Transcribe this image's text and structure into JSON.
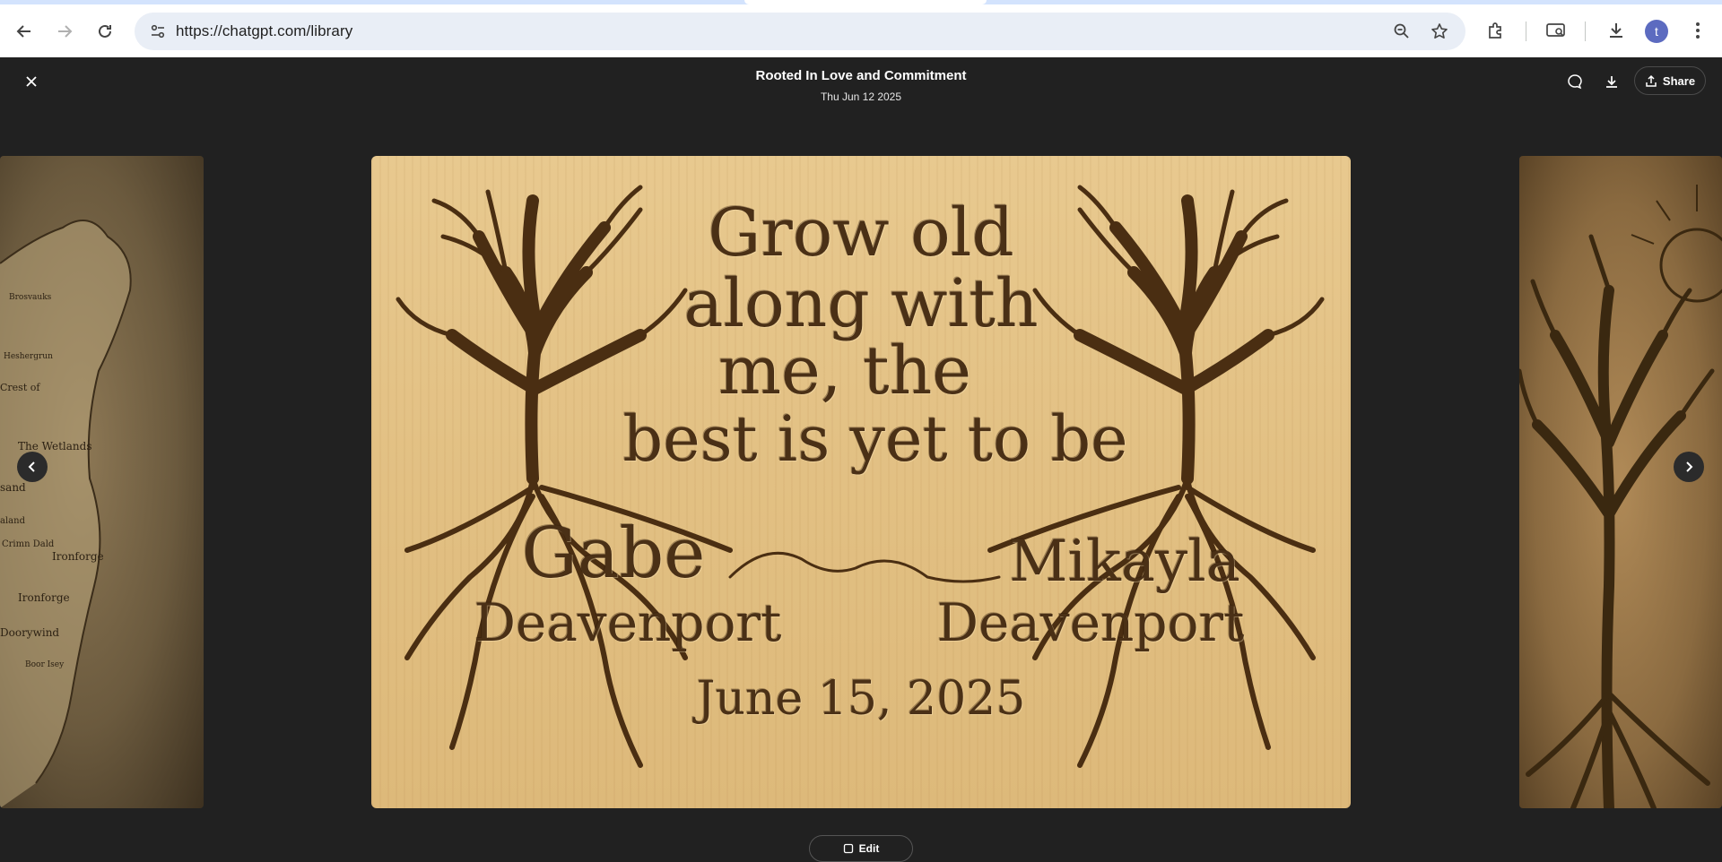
{
  "browser": {
    "url": "https://chatgpt.com/library",
    "profile_initial": "t",
    "icons": {
      "back": "arrow-left-icon",
      "forward": "arrow-right-icon",
      "reload": "reload-icon",
      "site_info": "tune-icon",
      "zoom": "zoom-icon",
      "bookmark": "star-icon",
      "extensions": "puzzle-icon",
      "cast": "cast-search-icon",
      "downloads": "download-icon",
      "menu": "kebab-menu-icon"
    }
  },
  "viewer": {
    "title": "Rooted In Love and Commitment",
    "date": "Thu Jun 12 2025",
    "share_label": "Share",
    "edit_label": "Edit"
  },
  "main_image": {
    "quote_lines": [
      "Grow old",
      "along with",
      "me, the",
      "best is yet to be"
    ],
    "name_left_first": "Gabe",
    "name_left_last": "Deavenport",
    "name_right_first": "Mikayla",
    "name_right_last": "Deavenport",
    "date_line": "June 15, 2025"
  },
  "left_image": {
    "labels": [
      "Brosvauks",
      "Heshergrun",
      "Crest of",
      "The Wetlands",
      "Crimn Dald",
      "Ironforge",
      "Ironforge",
      "Doorywind",
      "Boor Isey",
      "sand",
      "aland"
    ]
  },
  "colors": {
    "background": "#212121",
    "engrave": "#4a3016",
    "wood": "#e2c083"
  }
}
